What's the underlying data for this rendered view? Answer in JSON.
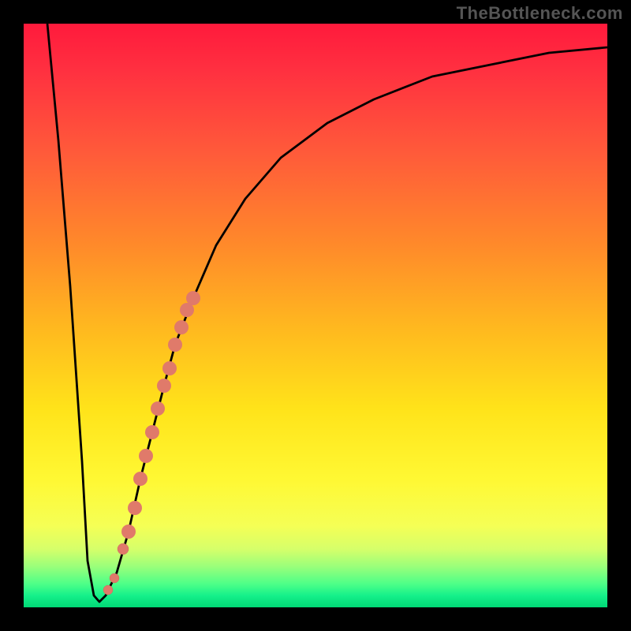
{
  "watermark": "TheBottleneck.com",
  "chart_data": {
    "type": "line",
    "title": "",
    "xlabel": "",
    "ylabel": "",
    "xlim": [
      0,
      100
    ],
    "ylim": [
      0,
      100
    ],
    "grid": false,
    "legend": false,
    "series": [
      {
        "name": "bottleneck-curve",
        "x": [
          4,
          6,
          8,
          10,
          11,
          12,
          13,
          14,
          16,
          18,
          20,
          22,
          24,
          26,
          29,
          33,
          38,
          44,
          52,
          60,
          70,
          80,
          90,
          100
        ],
        "y": [
          100,
          80,
          55,
          25,
          8,
          2,
          1,
          2,
          6,
          13,
          22,
          30,
          38,
          45,
          53,
          62,
          70,
          77,
          83,
          87,
          91,
          93,
          95,
          96
        ]
      }
    ],
    "highlight_points": {
      "name": "marked-segment",
      "x": [
        14.5,
        15.5,
        17,
        18,
        19,
        20,
        21,
        22,
        23,
        24,
        25,
        26,
        27,
        28,
        29
      ],
      "y": [
        3,
        5,
        10,
        13,
        17,
        22,
        26,
        30,
        34,
        38,
        41,
        45,
        48,
        51,
        53
      ]
    },
    "background_gradient": {
      "orientation": "vertical",
      "stops": [
        {
          "pos": 0.0,
          "color": "#ff1a3c"
        },
        {
          "pos": 0.22,
          "color": "#ff5a3a"
        },
        {
          "pos": 0.52,
          "color": "#ffb81f"
        },
        {
          "pos": 0.78,
          "color": "#fff833"
        },
        {
          "pos": 0.93,
          "color": "#9aff7a"
        },
        {
          "pos": 1.0,
          "color": "#00d976"
        }
      ]
    }
  }
}
